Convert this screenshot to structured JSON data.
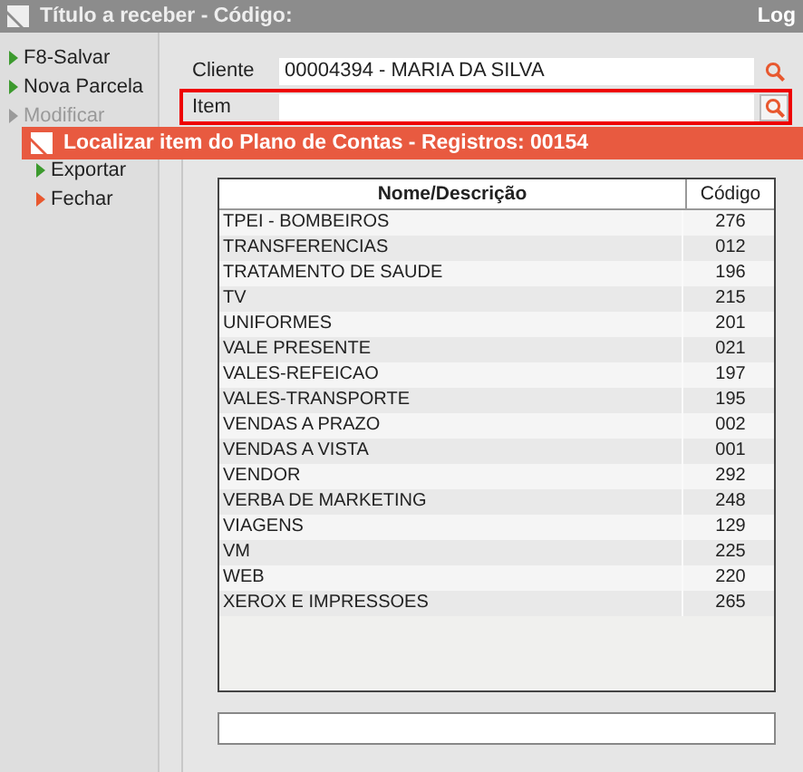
{
  "window": {
    "title": "Título a receber - Código:",
    "title_right": "Log"
  },
  "sidebar": {
    "items": [
      {
        "label": "F8-Salvar",
        "color": "#3c9a2e",
        "disabled": false
      },
      {
        "label": "Nova Parcela",
        "color": "#3c9a2e",
        "disabled": false
      },
      {
        "label": "Modificar",
        "color": "#9a9a9a",
        "disabled": true
      }
    ],
    "lower_items": [
      {
        "label": "Exportar",
        "color": "#3c9a2e"
      },
      {
        "label": "Fechar",
        "color": "#e8582f"
      }
    ]
  },
  "form": {
    "fields": [
      {
        "label": "Cliente",
        "value": "00004394 - MARIA DA SILVA",
        "highlighted": false
      },
      {
        "label": "Item",
        "highlighted": true
      }
    ]
  },
  "dialog": {
    "title": "Localizar item do Plano de Contas - Registros: 00154",
    "table": {
      "columns": [
        "Nome/Descrição",
        "Código"
      ],
      "rows": [
        [
          "TPEI - BOMBEIROS",
          "276"
        ],
        [
          "TRANSFERENCIAS",
          "012"
        ],
        [
          "TRATAMENTO DE SAUDE",
          "196"
        ],
        [
          "TV",
          "215"
        ],
        [
          "UNIFORMES",
          "201"
        ],
        [
          "VALE PRESENTE",
          "021"
        ],
        [
          "VALES-REFEICAO",
          "197"
        ],
        [
          "VALES-TRANSPORTE",
          "195"
        ],
        [
          "VENDAS A PRAZO",
          "002"
        ],
        [
          "VENDAS A VISTA",
          "001"
        ],
        [
          "VENDOR",
          "292"
        ],
        [
          "VERBA DE MARKETING",
          "248"
        ],
        [
          "VIAGENS",
          "129"
        ],
        [
          "VM",
          "225"
        ],
        [
          "WEB",
          "220"
        ],
        [
          "XEROX E IMPRESSOES",
          "265"
        ]
      ]
    }
  }
}
